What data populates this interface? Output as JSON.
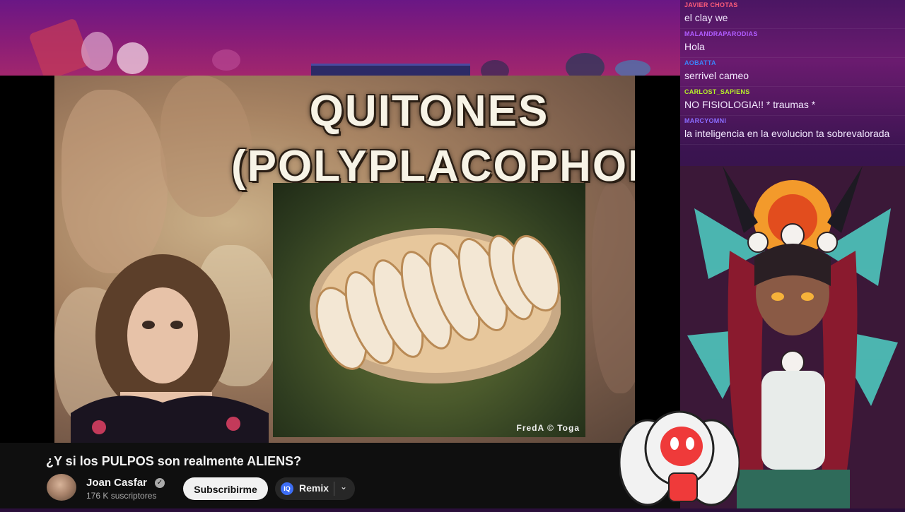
{
  "video": {
    "slide_title_line1": "QUITONES",
    "slide_title_line2": "(POLYPLACOPHORA)",
    "photo_credit": "FredA  ©  Toga",
    "title": "¿Y si los PULPOS son realmente ALIENS?",
    "channel": "Joan Casfar",
    "subscribers": "176 K suscriptores",
    "subscribe_label": "Subscribirme",
    "remix_label": "Remix",
    "remix_icon": "IQ"
  },
  "chat": {
    "messages": [
      {
        "user": "JAVIER CHOTAS",
        "user_color": "#ff5c7a",
        "text": "el clay we"
      },
      {
        "user": "MALANDRAPARODIAS",
        "user_color": "#b05cff",
        "text": "Hola"
      },
      {
        "user": "AOBATTA",
        "user_color": "#3b82f6",
        "text": "serrivel cameo"
      },
      {
        "user": "CARLOST_SAPIENS",
        "user_color": "#b8f02a",
        "text": "NO FISIOLOGIA!! * traumas *"
      },
      {
        "user": "MARCYOMNI",
        "user_color": "#8a6cff",
        "text": "la inteligencia en la evolucion ta sobrevalorada"
      }
    ]
  },
  "colors": {
    "yt_background": "#0f0f0f",
    "stream_purple": "#6a1785",
    "accent_blue": "#3d6ef5"
  }
}
